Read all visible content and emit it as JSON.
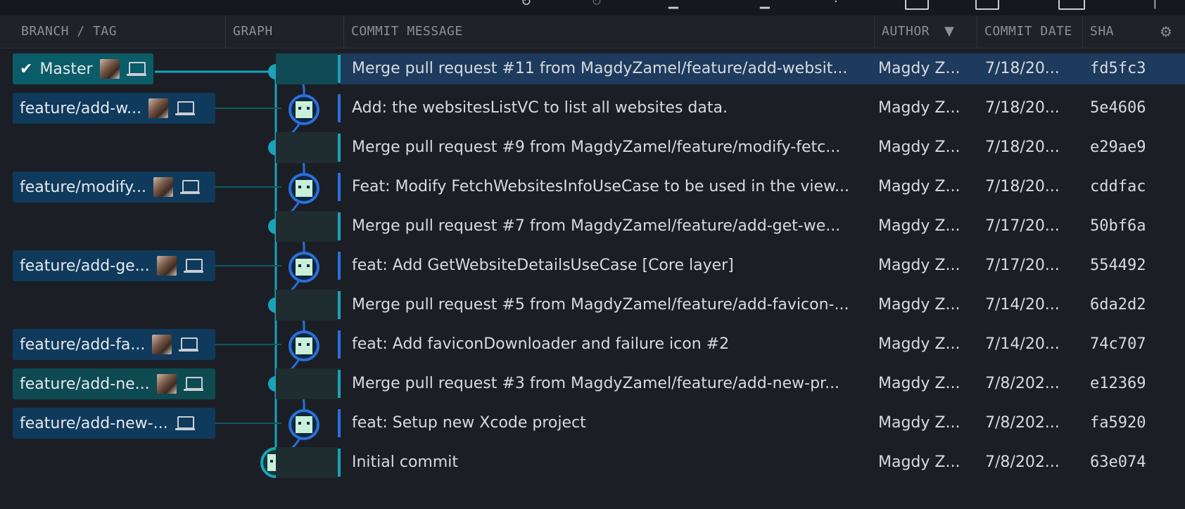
{
  "topbar": {
    "icons": [
      "refresh-icon",
      "refresh-disabled-icon",
      "pull-icon",
      "push-icon",
      "branch-icon",
      "stash-icon",
      "pop-icon",
      "terminal-icon",
      "more-icon"
    ]
  },
  "header": {
    "branch_tag": "BRANCH / TAG",
    "graph": "GRAPH",
    "commit_message": "COMMIT MESSAGE",
    "author": "AUTHOR",
    "commit_date": "COMMIT DATE",
    "sha": "SHA"
  },
  "branches": [
    {
      "label": "Master",
      "row": 0,
      "checked": true,
      "avatar": true
    },
    {
      "label": "feature/add-w...",
      "row": 1,
      "checked": false,
      "avatar": true
    },
    {
      "label": "feature/modify...",
      "row": 3,
      "checked": false,
      "avatar": true
    },
    {
      "label": "feature/add-ge...",
      "row": 5,
      "checked": false,
      "avatar": true
    },
    {
      "label": "feature/add-fa...",
      "row": 7,
      "checked": false,
      "avatar": true
    },
    {
      "label": "feature/add-ne...",
      "row": 8,
      "checked": false,
      "avatar": true
    },
    {
      "label": "feature/add-new-...",
      "row": 9,
      "checked": false,
      "avatar": false
    }
  ],
  "commits": [
    {
      "message": "Merge pull request #11 from MagdyZamel/feature/add-websit...",
      "author": "Magdy Z...",
      "date": "7/18/20...",
      "sha": "fd5fc3"
    },
    {
      "message": "Add: the websitesListVC to list all websites data.",
      "author": "Magdy Z...",
      "date": "7/18/20...",
      "sha": "5e4606"
    },
    {
      "message": "Merge pull request #9 from MagdyZamel/feature/modify-fetc...",
      "author": "Magdy Z...",
      "date": "7/18/20...",
      "sha": "e29ae9"
    },
    {
      "message": "Feat: Modify FetchWebsitesInfoUseCase to be used in the view...",
      "author": "Magdy Z...",
      "date": "7/18/20...",
      "sha": "cddfac"
    },
    {
      "message": "Merge pull request #7 from MagdyZamel/feature/add-get-we...",
      "author": "Magdy Z...",
      "date": "7/17/20...",
      "sha": "50bf6a"
    },
    {
      "message": "feat: Add GetWebsiteDetailsUseCase [Core layer]",
      "author": "Magdy Z...",
      "date": "7/17/20...",
      "sha": "554492"
    },
    {
      "message": "Merge pull request #5 from MagdyZamel/feature/add-favicon-...",
      "author": "Magdy Z...",
      "date": "7/14/20...",
      "sha": "6da2d2"
    },
    {
      "message": "feat: Add faviconDownloader and failure icon #2",
      "author": "Magdy Z...",
      "date": "7/14/20...",
      "sha": "74c707"
    },
    {
      "message": "Merge pull request #3 from MagdyZamel/feature/add-new-pr...",
      "author": "Magdy Z...",
      "date": "7/8/202...",
      "sha": "e12369"
    },
    {
      "message": "feat: Setup new Xcode project",
      "author": "Magdy Z...",
      "date": "7/8/202...",
      "sha": "fa5920"
    },
    {
      "message": "Initial commit",
      "author": "Magdy Z...",
      "date": "7/8/202...",
      "sha": "63e074"
    }
  ],
  "colors": {
    "background": "#1b1f25",
    "selected_row": "#1e3a5c",
    "branch_blue": "#2a6fdb",
    "branch_teal": "#1aa3b8",
    "avatar_node": "#c8f0d8"
  }
}
